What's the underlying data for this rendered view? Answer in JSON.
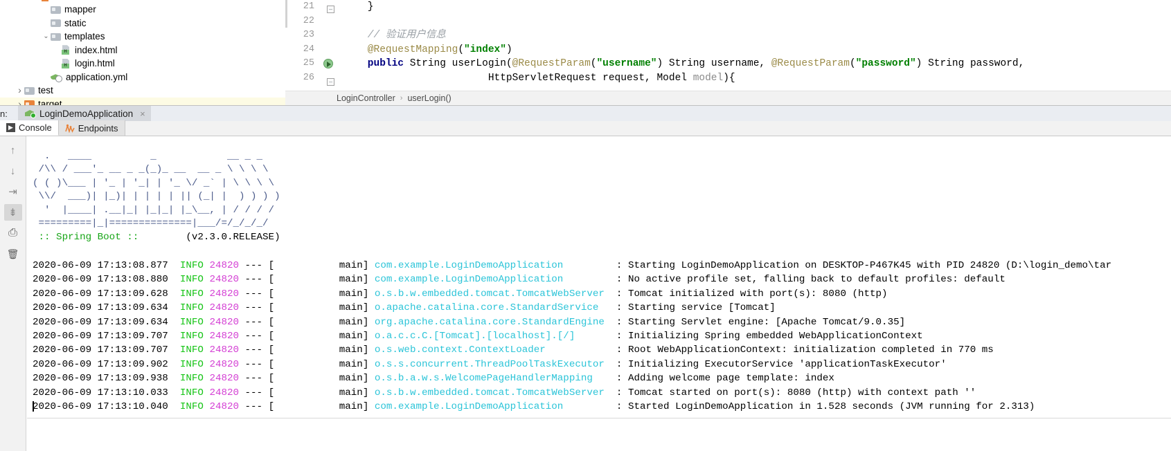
{
  "project_tree": {
    "items": [
      {
        "label": "mapper",
        "icon": "folder-icon",
        "indent": 78,
        "twisty": "",
        "type": "folder"
      },
      {
        "label": "static",
        "icon": "folder-icon",
        "indent": 78,
        "twisty": "",
        "type": "folder"
      },
      {
        "label": "templates",
        "icon": "folder-icon",
        "indent": 78,
        "twisty": "v",
        "type": "folder"
      },
      {
        "label": "index.html",
        "icon": "html-file-icon",
        "indent": 94,
        "twisty": "",
        "type": "html"
      },
      {
        "label": "login.html",
        "icon": "html-file-icon",
        "indent": 94,
        "twisty": "",
        "type": "html"
      },
      {
        "label": "application.yml",
        "icon": "yml-file-icon",
        "indent": 78,
        "twisty": "",
        "type": "yml"
      },
      {
        "label": "test",
        "icon": "folder-icon",
        "indent": 40,
        "twisty": ">",
        "type": "folder"
      },
      {
        "label": "target",
        "icon": "folder-icon-orange",
        "indent": 40,
        "twisty": ">",
        "type": "folder"
      }
    ]
  },
  "editor": {
    "line_numbers": [
      "21",
      "22",
      "23",
      "24",
      "25",
      "26"
    ],
    "lines": [
      {
        "indent": 4,
        "segments": [
          {
            "text": "}",
            "cls": ""
          }
        ]
      },
      {
        "indent": 0,
        "segments": [
          {
            "text": "",
            "cls": ""
          }
        ]
      },
      {
        "indent": 4,
        "segments": [
          {
            "text": "// 验证用户信息",
            "cls": "c-comment"
          }
        ]
      },
      {
        "indent": 4,
        "segments": [
          {
            "text": "@RequestMapping",
            "cls": "c-anno"
          },
          {
            "text": "(",
            "cls": ""
          },
          {
            "text": "\"index\"",
            "cls": "c-str"
          },
          {
            "text": ")",
            "cls": ""
          }
        ]
      },
      {
        "indent": 4,
        "segments": [
          {
            "text": "public",
            "cls": "c-kw"
          },
          {
            "text": " String userLogin(",
            "cls": ""
          },
          {
            "text": "@RequestParam",
            "cls": "c-anno"
          },
          {
            "text": "(",
            "cls": ""
          },
          {
            "text": "\"username\"",
            "cls": "c-str"
          },
          {
            "text": ") String username, ",
            "cls": ""
          },
          {
            "text": "@RequestParam",
            "cls": "c-anno"
          },
          {
            "text": "(",
            "cls": ""
          },
          {
            "text": "\"password\"",
            "cls": "c-str"
          },
          {
            "text": ") String password,",
            "cls": ""
          }
        ]
      },
      {
        "indent": 4,
        "segments": [
          {
            "text": "                    HttpServletRequest request, Model ",
            "cls": ""
          },
          {
            "text": "model",
            "cls": "c-param"
          },
          {
            "text": "){",
            "cls": ""
          }
        ]
      }
    ],
    "breadcrumb": {
      "class_name": "LoginController",
      "separator": "›",
      "method_name": "userLogin()"
    }
  },
  "run_window": {
    "label": "n:",
    "tab_title": "LoginDemoApplication",
    "tab_close": "×",
    "sub_tabs": [
      {
        "label": "Console",
        "icon": "console-icon",
        "active": true
      },
      {
        "label": "Endpoints",
        "icon": "endpoints-icon",
        "active": false
      }
    ],
    "toolbar_buttons": [
      {
        "name": "scroll-up-button",
        "glyph": "↑",
        "active": false
      },
      {
        "name": "scroll-down-button",
        "glyph": "↓",
        "active": false
      },
      {
        "name": "soft-wrap-button",
        "glyph": "⇥",
        "active": false
      },
      {
        "name": "scroll-to-end-button",
        "glyph": "⇟",
        "active": true
      },
      {
        "name": "print-button",
        "glyph": "⎙",
        "active": false
      },
      {
        "name": "clear-all-button",
        "glyph": "🗑",
        "active": false
      }
    ]
  },
  "console": {
    "banner": [
      "  .   ____          _            __ _ _",
      " /\\\\ / ___'_ __ _ _(_)_ __  __ _ \\ \\ \\ \\",
      "( ( )\\___ | '_ | '_| | '_ \\/ _` | \\ \\ \\ \\",
      " \\\\/  ___)| |_)| | | | | || (_| |  ) ) ) )",
      "  '  |____| .__|_| |_|_| |_\\__, | / / / /",
      " =========|_|==============|___/=/_/_/_/"
    ],
    "spring_name": " :: Spring Boot :: ",
    "spring_version": "       (v2.3.0.RELEASE)",
    "log_lines": [
      {
        "time": "2020-06-09 17:13:08.877",
        "level": "INFO",
        "pid": "24820",
        "dash": "---",
        "thread": "[           main]",
        "logger": "com.example.LoginDemoApplication",
        "message": ": Starting LoginDemoApplication on DESKTOP-P467K45 with PID 24820 (D:\\login_demo\\tar"
      },
      {
        "time": "2020-06-09 17:13:08.880",
        "level": "INFO",
        "pid": "24820",
        "dash": "---",
        "thread": "[           main]",
        "logger": "com.example.LoginDemoApplication",
        "message": ": No active profile set, falling back to default profiles: default"
      },
      {
        "time": "2020-06-09 17:13:09.628",
        "level": "INFO",
        "pid": "24820",
        "dash": "---",
        "thread": "[           main]",
        "logger": "o.s.b.w.embedded.tomcat.TomcatWebServer",
        "message": ": Tomcat initialized with port(s): 8080 (http)"
      },
      {
        "time": "2020-06-09 17:13:09.634",
        "level": "INFO",
        "pid": "24820",
        "dash": "---",
        "thread": "[           main]",
        "logger": "o.apache.catalina.core.StandardService",
        "message": ": Starting service [Tomcat]"
      },
      {
        "time": "2020-06-09 17:13:09.634",
        "level": "INFO",
        "pid": "24820",
        "dash": "---",
        "thread": "[           main]",
        "logger": "org.apache.catalina.core.StandardEngine",
        "message": ": Starting Servlet engine: [Apache Tomcat/9.0.35]"
      },
      {
        "time": "2020-06-09 17:13:09.707",
        "level": "INFO",
        "pid": "24820",
        "dash": "---",
        "thread": "[           main]",
        "logger": "o.a.c.c.C.[Tomcat].[localhost].[/]",
        "message": ": Initializing Spring embedded WebApplicationContext"
      },
      {
        "time": "2020-06-09 17:13:09.707",
        "level": "INFO",
        "pid": "24820",
        "dash": "---",
        "thread": "[           main]",
        "logger": "o.s.web.context.ContextLoader",
        "message": ": Root WebApplicationContext: initialization completed in 770 ms"
      },
      {
        "time": "2020-06-09 17:13:09.902",
        "level": "INFO",
        "pid": "24820",
        "dash": "---",
        "thread": "[           main]",
        "logger": "o.s.s.concurrent.ThreadPoolTaskExecutor",
        "message": ": Initializing ExecutorService 'applicationTaskExecutor'"
      },
      {
        "time": "2020-06-09 17:13:09.938",
        "level": "INFO",
        "pid": "24820",
        "dash": "---",
        "thread": "[           main]",
        "logger": "o.s.b.a.w.s.WelcomePageHandlerMapping",
        "message": ": Adding welcome page template: index"
      },
      {
        "time": "2020-06-09 17:13:10.033",
        "level": "INFO",
        "pid": "24820",
        "dash": "---",
        "thread": "[           main]",
        "logger": "o.s.b.w.embedded.tomcat.TomcatWebServer",
        "message": ": Tomcat started on port(s): 8080 (http) with context path ''"
      },
      {
        "time": "2020-06-09 17:13:10.040",
        "level": "INFO",
        "pid": "24820",
        "dash": "---",
        "thread": "[           main]",
        "logger": "com.example.LoginDemoApplication",
        "message": ": Started LoginDemoApplication in 1.528 seconds (JVM running for 2.313)"
      }
    ]
  },
  "colors": {
    "level": "#16c416",
    "pid": "#d43fd4",
    "logger": "#2bc4d8",
    "banner": "#4a5a8a",
    "spring_green": "#16a516",
    "string": "#008000",
    "annotation": "#9b8b48",
    "keyword": "#000080"
  }
}
